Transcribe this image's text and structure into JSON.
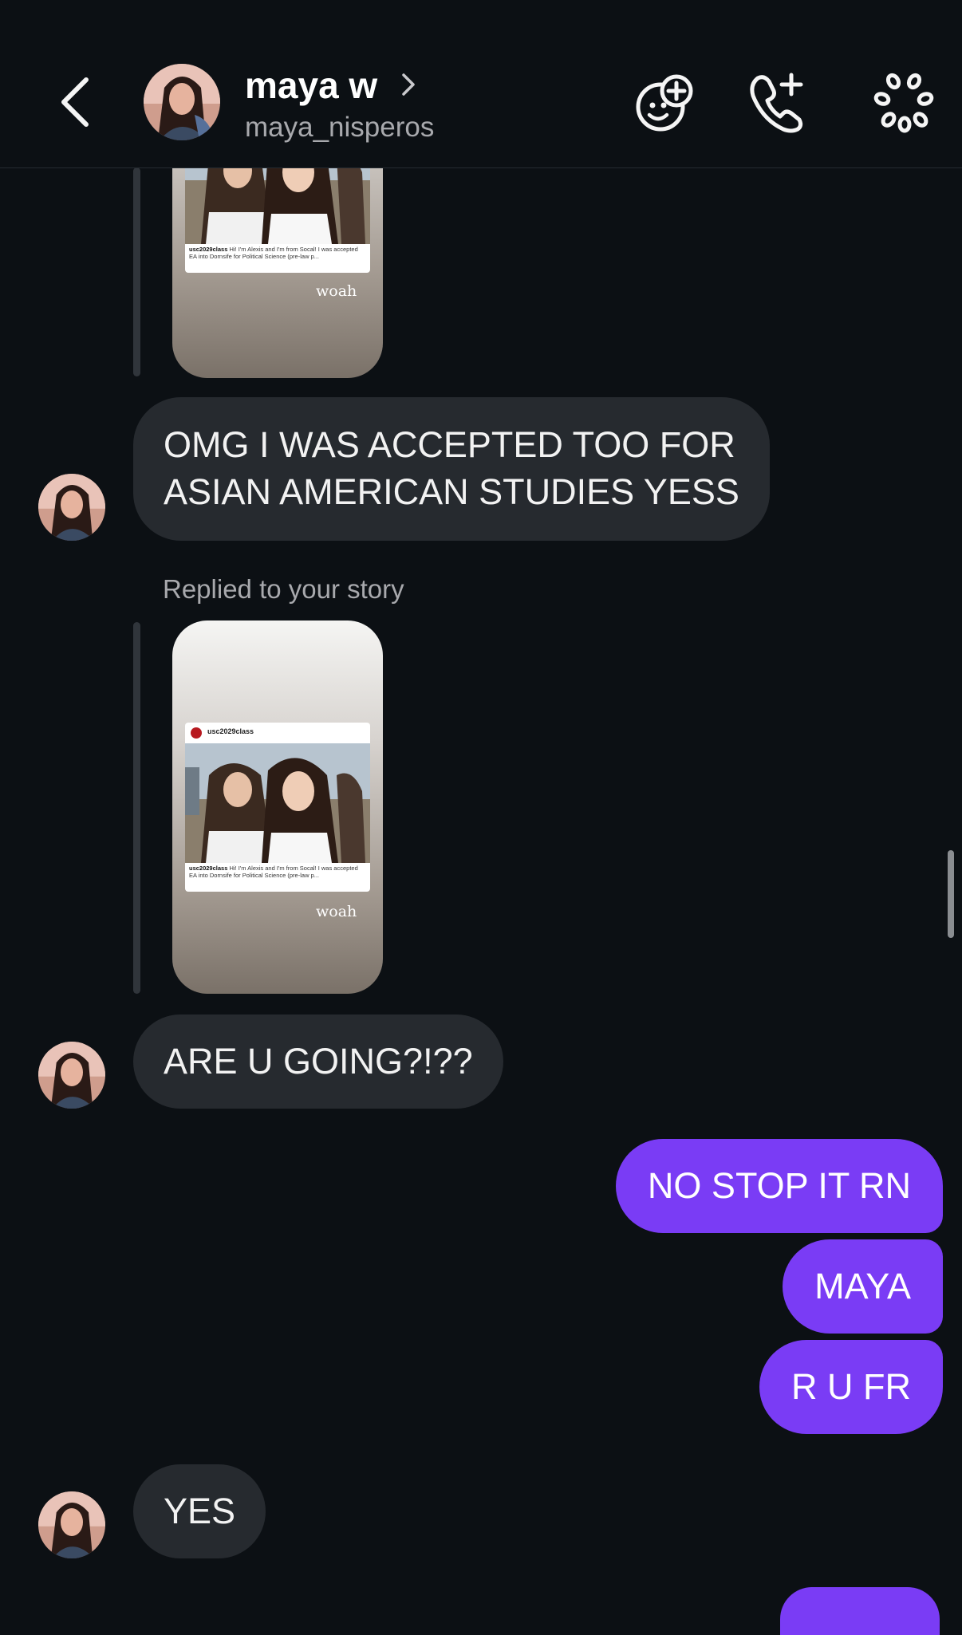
{
  "header": {
    "name": "maya w",
    "username": "maya_nisperos",
    "icons": [
      "back-chevron-icon",
      "sticker-add-icon",
      "phone-plus-icon",
      "more-flower-icon"
    ]
  },
  "story_cards": [
    {
      "post_user": "usc2029class",
      "caption_user": "usc2029class",
      "caption_text": "Hi! I'm Alexis and I'm from Socal! I was accepted EA into Dornsife for Political Science (pre-law p...",
      "overlay": "woah"
    },
    {
      "post_user": "usc2029class",
      "caption_user": "usc2029class",
      "caption_text": "Hi! I'm Alexis and I'm from Socal! I was accepted EA into Dornsife for Political Science (pre-law p...",
      "overlay": "woah"
    }
  ],
  "messages": {
    "m1_line1": "OMG I WAS ACCEPTED TOO FOR",
    "m1_line2": "ASIAN AMERICAN STUDIES YESS",
    "reply_label": "Replied to your story",
    "m2": "ARE U GOING?!??",
    "out1": "NO STOP IT RN",
    "out2": "MAYA",
    "out3": "R U FR",
    "m3": "YES"
  },
  "colors": {
    "background": "#0c1014",
    "incoming_bubble": "#262a2f",
    "outgoing_bubble": "#7a3cf5",
    "secondary_text": "#a8a9ad"
  }
}
